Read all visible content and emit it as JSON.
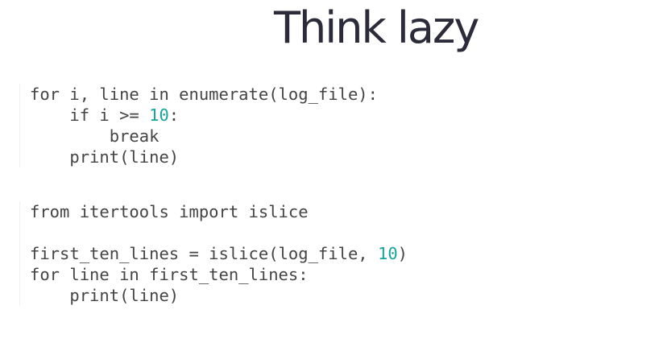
{
  "slide": {
    "title": "Think lazy"
  },
  "code_blocks": [
    {
      "lines": [
        {
          "text": "for i, line in enumerate(log_file):"
        },
        {
          "pre": "    if i >= ",
          "num": "10",
          "post": ":"
        },
        {
          "text": "        break"
        },
        {
          "text": "    print(line)"
        }
      ]
    },
    {
      "lines": [
        {
          "text": "from itertools import islice"
        },
        {
          "text": ""
        },
        {
          "pre": "first_ten_lines = islice(log_file, ",
          "num": "10",
          "post": ")"
        },
        {
          "text": "for line in first_ten_lines:"
        },
        {
          "text": "    print(line)"
        }
      ]
    }
  ],
  "colors": {
    "title": "#2b2b3a",
    "code_text": "#444444",
    "number_literal": "#1aa39a"
  }
}
